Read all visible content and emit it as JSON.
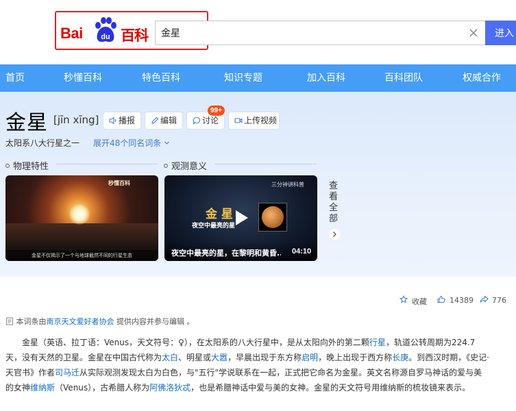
{
  "header": {
    "logo": {
      "bai": "Bai",
      "du": "du",
      "baike": "百科"
    },
    "search_value": "金星",
    "search_button": "进入"
  },
  "nav": [
    "首页",
    "秒懂百科",
    "特色百科",
    "知识专题",
    "加入百科",
    "百科团队",
    "权威合作"
  ],
  "entry": {
    "title": "金星",
    "pinyin": "[jīn xīng]",
    "tools": {
      "read": "播报",
      "edit": "编辑",
      "discuss": "讨论",
      "upload": "上传视频"
    },
    "discuss_badge": "99+",
    "subtitle": "太阳系八大行星之一",
    "expand": "展开48个同名词条"
  },
  "sections": {
    "physical": "物理特性",
    "observe": "观测意义"
  },
  "videos": [
    {
      "watermark": "秒懂百科",
      "caption": "金星不仅揭示了一个与地球截然不同的行星生态"
    },
    {
      "brand": "三分钟讲科普",
      "overlay_big": "金 星",
      "overlay_small": "夜空中最亮的星",
      "title": "夜空中最亮的星，在黎明和黄昏...",
      "duration": "04:10"
    }
  ],
  "see_all": "查看全部",
  "actions": {
    "favorite": "收藏",
    "likes": "14389",
    "shares": "776"
  },
  "notice": {
    "prefix": "本词条由",
    "source": "南京天文爱好者协会",
    "suffix": "提供内容并参与编辑",
    "end": "。"
  },
  "content": {
    "p1_a": "金星（英语、拉丁语：Venus，天文符号：♀），在太阳系的八大行星中，是从太阳向外的第二颗",
    "link_planet": "行星",
    "p1_b": "，轨道公转周期为224.7天，没有天然的卫星。金星在中国古代称为",
    "link_taibai": "太白",
    "p1_c": "、明星或",
    "link_dahao": "大嚣",
    "p1_d": "，早晨出现于东方称",
    "link_qiming": "启明",
    "p1_e": "，晚上出现于西方称",
    "link_changgeng": "长庚",
    "p1_f": "。到西汉时期，《史记·天官书》作者",
    "link_simaqian": "司马迁",
    "p1_g": "从实际观测发现太白为白色，与\"五行\"学说联系在一起，正式把它命名为金星。英文名称源自罗马神话的爱与美的女神",
    "link_venus": "维纳斯",
    "p1_h": "（Venus），古希腊人称为",
    "link_aphrodite": "阿佛洛狄忒",
    "p1_i": "，也是希腊神话中爱与美的女神。金星的天文符号用维纳斯的梳妆镜来表示。"
  },
  "colors": {
    "brand_red": "#e10601",
    "nav_blue": "#459df5",
    "link_blue": "#136ec2",
    "search_blue": "#4e6ef2"
  }
}
